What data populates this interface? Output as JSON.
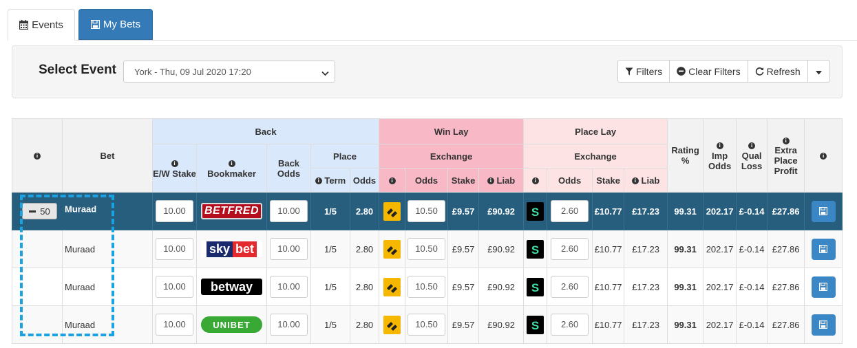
{
  "tabs": [
    {
      "label": "Events",
      "active": true
    },
    {
      "label": "My Bets",
      "active": false
    }
  ],
  "selector": {
    "label": "Select Event",
    "value": "York - Thu, 09 Jul 2020 17:20"
  },
  "toolbar": {
    "filters": "Filters",
    "clear_filters": "Clear Filters",
    "refresh": "Refresh"
  },
  "headers": {
    "bet": "Bet",
    "back": "Back",
    "win_lay": "Win Lay",
    "place_lay": "Place Lay",
    "ew_stake": "E/W Stake",
    "bookmaker": "Bookmaker",
    "back_odds": "Back Odds",
    "place": "Place",
    "exchange": "Exchange",
    "term": "Term",
    "odds": "Odds",
    "stake": "Stake",
    "liab": "Liab",
    "rating": "Rating %",
    "imp_odds": "Imp Odds",
    "qual_loss": "Qual Loss",
    "extra_place_profit": "Extra Place Profit"
  },
  "collapse_value": "50",
  "rows": [
    {
      "name": "Muraad",
      "ew_stake": "10.00",
      "bookmaker": "BETFRED",
      "back_odds": "10.00",
      "term": "1/5",
      "place_odds": "2.80",
      "win_odds": "10.50",
      "win_stake": "£9.57",
      "win_liab": "£90.92",
      "place_odds_lay": "2.60",
      "place_stake": "£10.77",
      "place_liab": "£17.23",
      "rating": "99.31",
      "imp_odds": "202.17",
      "qual_loss": "£-0.14",
      "extra_profit": "£27.86"
    },
    {
      "name": "Muraad",
      "ew_stake": "10.00",
      "bookmaker": "skybet",
      "back_odds": "10.00",
      "term": "1/5",
      "place_odds": "2.80",
      "win_odds": "10.50",
      "win_stake": "£9.57",
      "win_liab": "£90.92",
      "place_odds_lay": "2.60",
      "place_stake": "£10.77",
      "place_liab": "£17.23",
      "rating": "99.31",
      "imp_odds": "202.17",
      "qual_loss": "£-0.14",
      "extra_profit": "£27.86"
    },
    {
      "name": "Muraad",
      "ew_stake": "10.00",
      "bookmaker": "betway",
      "back_odds": "10.00",
      "term": "1/5",
      "place_odds": "2.80",
      "win_odds": "10.50",
      "win_stake": "£9.57",
      "win_liab": "£90.92",
      "place_odds_lay": "2.60",
      "place_stake": "£10.77",
      "place_liab": "£17.23",
      "rating": "99.31",
      "imp_odds": "202.17",
      "qual_loss": "£-0.14",
      "extra_profit": "£27.86"
    },
    {
      "name": "Muraad",
      "ew_stake": "10.00",
      "bookmaker": "UNIBET",
      "back_odds": "10.00",
      "term": "1/5",
      "place_odds": "2.80",
      "win_odds": "10.50",
      "win_stake": "£9.57",
      "win_liab": "£90.92",
      "place_odds_lay": "2.60",
      "place_stake": "£10.77",
      "place_liab": "£17.23",
      "rating": "99.31",
      "imp_odds": "202.17",
      "qual_loss": "£-0.14",
      "extra_profit": "£27.86"
    }
  ],
  "colors": {
    "primary": "#337ab7",
    "active_row": "#285e7d",
    "back_header": "#d9e8fb",
    "win_lay_header": "#f8b8c6",
    "place_lay_header": "#fde3e3",
    "highlight_dash": "#1aa3e0"
  }
}
